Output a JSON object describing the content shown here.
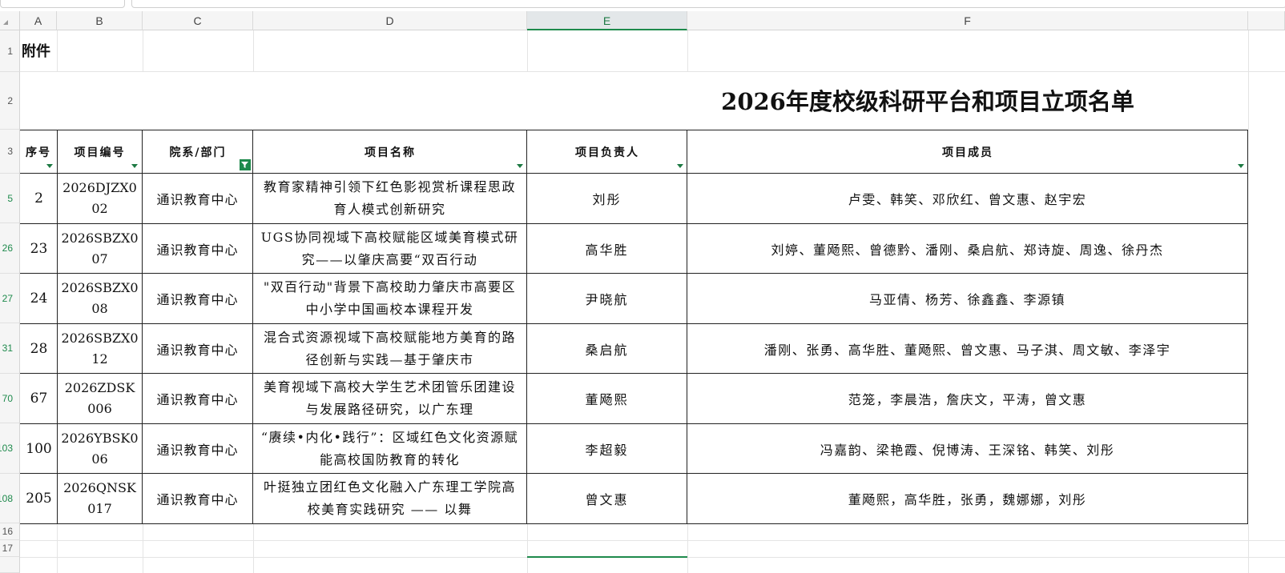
{
  "sheet": {
    "columns": [
      "A",
      "B",
      "C",
      "D",
      "E",
      "F"
    ],
    "selected_column": "E",
    "row_numbers": [
      "1",
      "2",
      "3",
      "5",
      "26",
      "27",
      "31",
      "70",
      "103",
      "108",
      "16",
      "17"
    ],
    "attachment_label": "附件",
    "title": "2026年度校级科研平台和项目立项名单"
  },
  "table": {
    "headers": [
      "序号",
      "项目编号",
      "院系/部门",
      "项目名称",
      "项目负责人",
      "项目成员"
    ],
    "rows": [
      {
        "no": "2",
        "code": "2026DJZX002",
        "dept": "通识教育中心",
        "name": "教育家精神引领下红色影视赏析课程思政育人模式创新研究",
        "leader": "刘彤",
        "members": "卢雯、韩笑、邓欣红、曾文惠、赵宇宏"
      },
      {
        "no": "23",
        "code": "2026SBZX007",
        "dept": "通识教育中心",
        "name": "UGS协同视域下高校赋能区域美育模式研究——以肇庆高要“双百行动",
        "leader": "高华胜",
        "members": "刘婷、董飏熙、曾德黔、潘刚、桑启航、郑诗旋、周逸、徐丹杰"
      },
      {
        "no": "24",
        "code": "2026SBZX008",
        "dept": "通识教育中心",
        "name": "\"双百行动\"背景下高校助力肇庆市高要区中小学中国画校本课程开发",
        "leader": "尹晓航",
        "members": "马亚倩、杨芳、徐鑫鑫、李源镇"
      },
      {
        "no": "28",
        "code": "2026SBZX012",
        "dept": "通识教育中心",
        "name": "混合式资源视域下高校赋能地方美育的路径创新与实践—基于肇庆市",
        "leader": "桑启航",
        "members": "潘刚、张勇、高华胜、董飏熙、曾文惠、马子淇、周文敏、李泽宇"
      },
      {
        "no": "67",
        "code": "2026ZDSK006",
        "dept": "通识教育中心",
        "name": "美育视域下高校大学生艺术团管乐团建设与发展路径研究，以广东理",
        "leader": "董飏熙",
        "members": "范笼，李晨浩，詹庆文，平涛，曾文惠"
      },
      {
        "no": "100",
        "code": "2026YBSK006",
        "dept": "通识教育中心",
        "name": "“赓续•内化•践行”：区域红色文化资源赋能高校国防教育的转化",
        "leader": "李超毅",
        "members": "冯嘉韵、梁艳霞、倪博涛、王深铭、韩笑、刘彤"
      },
      {
        "no": "205",
        "code": "2026QNSK017",
        "dept": "通识教育中心",
        "name": "叶挺独立团红色文化融入广东理工学院高校美育实践研究 —— 以舞",
        "leader": "曾文惠",
        "members": "董飏熙，高华胜，张勇，魏娜娜，刘彤"
      }
    ]
  }
}
